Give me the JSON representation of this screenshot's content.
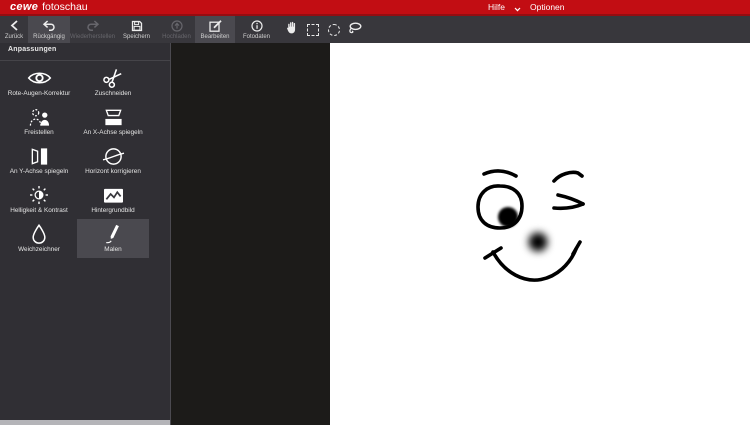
{
  "header": {
    "logo": {
      "primary": "cewe",
      "secondary": "fotoschau"
    },
    "menu": {
      "help": "Hilfe",
      "options": "Optionen"
    }
  },
  "toolbar": {
    "buttons": [
      {
        "label": "Zurück",
        "icon": "chevron-left-icon",
        "state": "normal"
      },
      {
        "label": "Rückgängig",
        "icon": "undo-arrow-icon",
        "state": "highlighted"
      },
      {
        "label": "Wiederherstellen",
        "icon": "redo-arrow-icon",
        "state": "disabled"
      },
      {
        "label": "Speichern",
        "icon": "floppy-disk-icon",
        "state": "normal"
      },
      {
        "label": "Hochladen",
        "icon": "upload-circle-icon",
        "state": "disabled"
      },
      {
        "label": "Bearbeiten",
        "icon": "edit-square-icon",
        "state": "selected"
      },
      {
        "label": "Fotodaten",
        "icon": "info-circle-icon",
        "state": "normal"
      }
    ],
    "tools": [
      {
        "name": "hand-tool"
      },
      {
        "name": "rectangle-select-tool"
      },
      {
        "name": "ellipse-select-tool"
      },
      {
        "name": "lasso-select-tool"
      }
    ]
  },
  "sidebar": {
    "title": "Anpassungen",
    "tools": [
      {
        "label": "Rote-Augen-Korrektur",
        "icon": "eye-icon",
        "selected": false
      },
      {
        "label": "Zuschneiden",
        "icon": "scissors-icon",
        "selected": false
      },
      {
        "label": "Freistellen",
        "icon": "person-cutout-icon",
        "selected": false
      },
      {
        "label": "An X-Achse spiegeln",
        "icon": "flip-x-axis-icon",
        "selected": false
      },
      {
        "label": "An Y-Achse spiegeln",
        "icon": "flip-y-axis-icon",
        "selected": false
      },
      {
        "label": "Horizont korrigieren",
        "icon": "horizon-icon",
        "selected": false
      },
      {
        "label": "Helligkeit & Kontrast",
        "icon": "brightness-sun-icon",
        "selected": false
      },
      {
        "label": "Hintergrundbild",
        "icon": "background-image-icon",
        "selected": false
      },
      {
        "label": "Weichzeichner",
        "icon": "water-drop-icon",
        "selected": false
      },
      {
        "label": "Malen",
        "icon": "paint-pen-icon",
        "selected": true
      }
    ]
  },
  "colors": {
    "accent_red": "#c20d13",
    "toolbar_bg": "#38373c",
    "sidebar_bg": "#302f34",
    "selected_bg": "#4a494f",
    "canvas_black": "#1c1b19",
    "canvas_white": "#ffffff",
    "scrollbar_gray": "#b4b4b8",
    "ink": "#000000"
  }
}
